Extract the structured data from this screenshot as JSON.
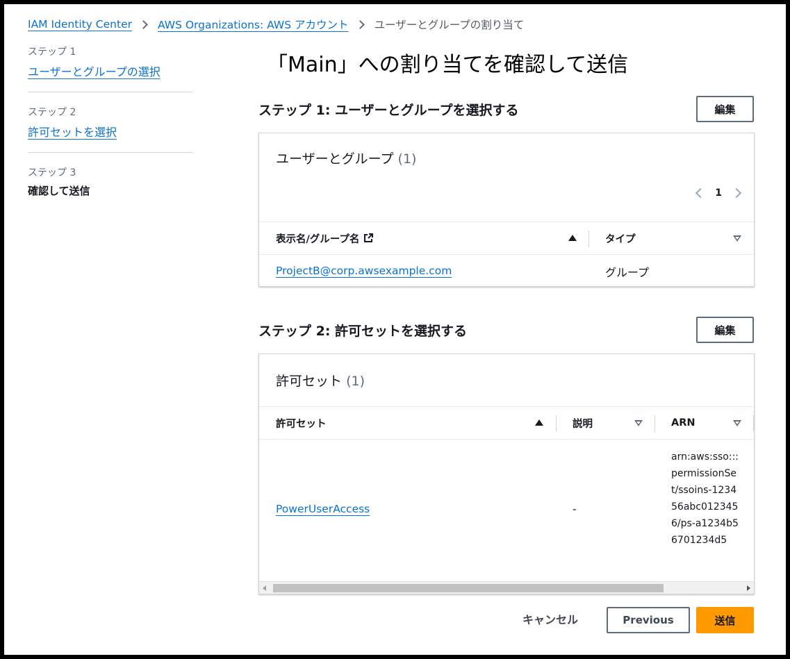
{
  "breadcrumb": {
    "items": [
      "IAM Identity Center",
      "AWS Organizations: AWS アカウント"
    ],
    "current": "ユーザーとグループの割り当て"
  },
  "sidebar": {
    "steps": [
      {
        "step": "ステップ 1",
        "label": "ユーザーとグループの選択"
      },
      {
        "step": "ステップ 2",
        "label": "許可セットを選択"
      },
      {
        "step": "ステップ 3",
        "label": "確認して送信"
      }
    ]
  },
  "page": {
    "title": "「Main」への割り当てを確認して送信"
  },
  "section1": {
    "title": "ステップ 1: ユーザーとグループを選択する",
    "edit_label": "編集",
    "card_title": "ユーザーとグループ",
    "count": "(1)",
    "page_number": "1",
    "columns": [
      "表示名/グループ名",
      "タイプ"
    ],
    "rows": [
      {
        "name": "ProjectB@corp.awsexample.com",
        "type": "グループ"
      }
    ]
  },
  "section2": {
    "title": "ステップ 2: 許可セットを選択する",
    "edit_label": "編集",
    "card_title": "許可セット",
    "count": "(1)",
    "columns": [
      "許可セット",
      "説明",
      "ARN"
    ],
    "rows": [
      {
        "name": "PowerUserAccess",
        "description": "-",
        "arn": "arn:aws:sso:::permissionSet/ssoins-123456abc0123456/ps-a1234b56701234d5"
      }
    ]
  },
  "footer": {
    "cancel_label": "キャンセル",
    "previous_label": "Previous",
    "submit_label": "送信"
  },
  "colors": {
    "link": "#0972d3",
    "primary_button": "#ff9900"
  }
}
